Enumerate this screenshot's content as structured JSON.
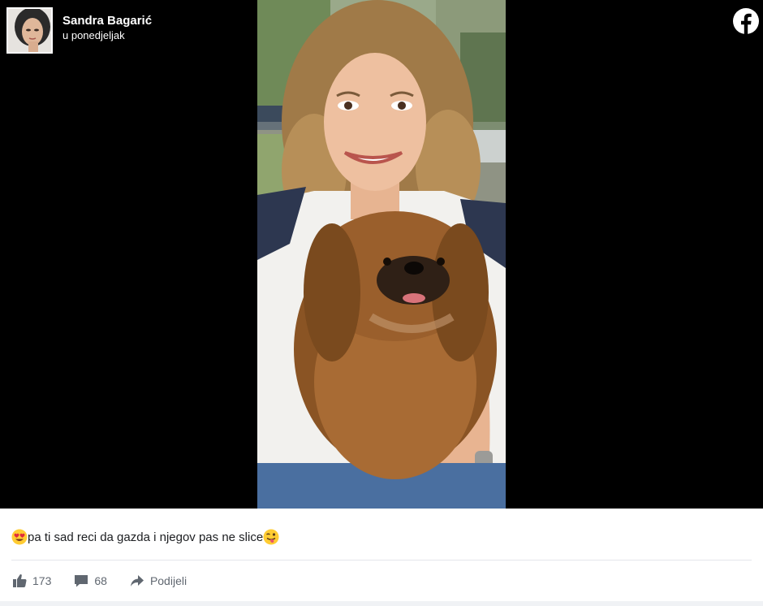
{
  "post": {
    "author": "Sandra Bagarić",
    "timestamp": "u ponedjeljak",
    "caption_text": "pa ti sad reci da gazda i njegov pas ne slice",
    "caption_emoji_start": "heart-eyes-emoji",
    "caption_emoji_end": "winking-tongue-emoji"
  },
  "engagement": {
    "likes": "173",
    "comments": "68",
    "share_label": "Podijeli"
  },
  "icons": {
    "platform_logo": "facebook-icon",
    "like": "thumbs-up-icon",
    "comment": "comment-bubble-icon",
    "share": "share-arrow-icon"
  },
  "colors": {
    "media_background": "#000000",
    "meta_text": "#606770",
    "caption_text": "#1c1e21"
  }
}
